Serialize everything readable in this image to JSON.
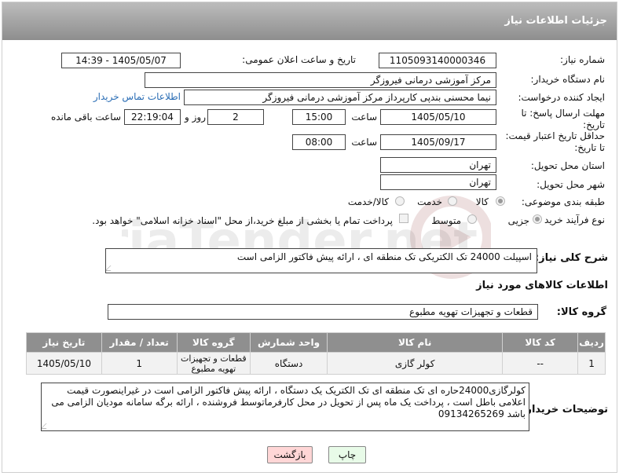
{
  "header": {
    "title": "جزئیات اطلاعات نیاز"
  },
  "form": {
    "need_number": {
      "label": "شماره نیاز:",
      "value": "1105093140000346"
    },
    "announce": {
      "label": "تاریخ و ساعت اعلان عمومی:",
      "value": "1405/05/07 - 14:39"
    },
    "buyer_org": {
      "label": "نام دستگاه خریدار:",
      "value": "مرکز آموزشی درمانی فیروزگر"
    },
    "requester": {
      "label": "ایجاد کننده درخواست:",
      "value": "نیما محسنی بندپی کارپرداز مرکز آموزشی درمانی فیروزگر",
      "contact_link": "اطلاعات تماس خریدار"
    },
    "reply_deadline": {
      "label": "مهلت ارسال پاسخ: تا تاریخ:",
      "date": "1405/05/10",
      "time_label": "ساعت",
      "time": "15:00",
      "days": "2",
      "days_label": "روز و",
      "remaining": "22:19:04",
      "remaining_label": "ساعت باقی مانده"
    },
    "price_validity": {
      "label": "حداقل تاریخ اعتبار قیمت: تا تاریخ:",
      "date": "1405/09/17",
      "time_label": "ساعت",
      "time": "08:00"
    },
    "delivery_province": {
      "label": "استان محل تحویل:",
      "value": "تهران"
    },
    "delivery_city": {
      "label": "شهر محل تحویل:",
      "value": "تهران"
    },
    "category": {
      "label": "طبقه بندی موضوعی:",
      "options": [
        "کالا",
        "خدمت",
        "کالا/خدمت"
      ],
      "selected": "کالا"
    },
    "process": {
      "label": "نوع فرآیند خرید :",
      "options": [
        "جزیی",
        "متوسط"
      ],
      "selected": "جزیی",
      "payment_note": "پرداخت تمام یا بخشی از مبلغ خرید،از محل \"اسناد خزانه اسلامی\" خواهد بود."
    }
  },
  "description": {
    "label": "شرح کلی نیاز:",
    "value": "اسپیلت 24000 تک الکتریکی تک منطقه ای ، ارائه پیش فاکتور الزامی است"
  },
  "goods": {
    "section_title": "اطلاعات کالاهای مورد نیاز",
    "group_label": "گروه کالا:",
    "group_value": "قطعات و تجهیزات تهویه مطبوع",
    "columns": [
      "ردیف",
      "کد کالا",
      "نام کالا",
      "واحد شمارش",
      "گروه کالا",
      "تعداد / مقدار",
      "تاریخ نیاز"
    ],
    "rows": [
      {
        "row": "1",
        "code": "--",
        "name": "کولر گازی",
        "unit": "دستگاه",
        "group": "قطعات و تجهیزات تهویه مطبوع",
        "qty": "1",
        "date": "1405/05/10"
      }
    ]
  },
  "buyer_notes": {
    "label": "توضیحات خریدار:",
    "value": "کولرگازی24000حاره ای تک منطقه ای تک الکتریک یک دستگاه ، ارائه پیش فاکتور الزامی است در غیراینصورت قیمت اعلامی باطل است ، پرداخت یک ماه پس از تحویل در محل کارفرماتوسط فروشنده ، ارائه برگه سامانه مودیان الزامی می باشد 09134265269"
  },
  "buttons": {
    "print": "چاپ",
    "back": "بازگشت"
  },
  "watermark": {
    "text": "AriaTender.net"
  },
  "colors": {
    "header": "#a5a5a5",
    "link": "#2a6db5",
    "back_button": "#ffd6d6",
    "print_button": "#e8fbe8"
  }
}
